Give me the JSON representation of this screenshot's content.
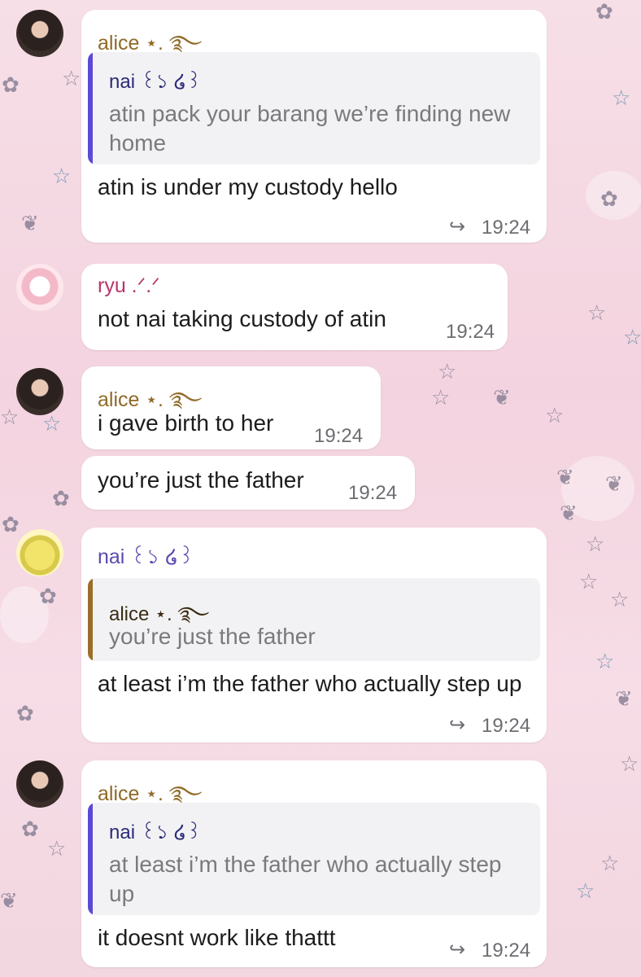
{
  "messages": [
    {
      "sender": "alice ⋆. ࿐",
      "quote": {
        "sender": "nai ꒰১ ໒꒱",
        "text": "atin pack your barang we’re finding new home"
      },
      "text": "atin is under my custody hello",
      "time": "19:24",
      "forward_icon": "reply-arrow-icon"
    },
    {
      "sender": "ryu .ᐟ.ᐟ",
      "text": "not nai taking custody of atin",
      "time": "19:24"
    },
    {
      "sender": "alice ⋆. ࿐",
      "text": "i gave birth to her",
      "time": "19:24"
    },
    {
      "text": "you’re just the father",
      "time": "19:24"
    },
    {
      "sender": "nai ꒰১ ໒꒱",
      "quote": {
        "sender": "alice ⋆. ࿐",
        "text": "you’re just the father"
      },
      "text": "at least i’m the father who actually step up",
      "time": "19:24",
      "forward_icon": "reply-arrow-icon"
    },
    {
      "sender": "alice ⋆. ࿐",
      "quote": {
        "sender": "nai ꒰১ ໒꒱",
        "text": "at least i’m the father who actually step up"
      },
      "text": "it doesnt work like thattt",
      "time": "19:24",
      "forward_icon": "reply-arrow-icon"
    }
  ],
  "colors": {
    "alice_name": "#8f6a28",
    "ryu_name": "#b8336a",
    "nai_name": "#5b4ab0",
    "quote_bar_nai": "#5b4ad6",
    "quote_bar_alice": "#9a6e2a"
  }
}
